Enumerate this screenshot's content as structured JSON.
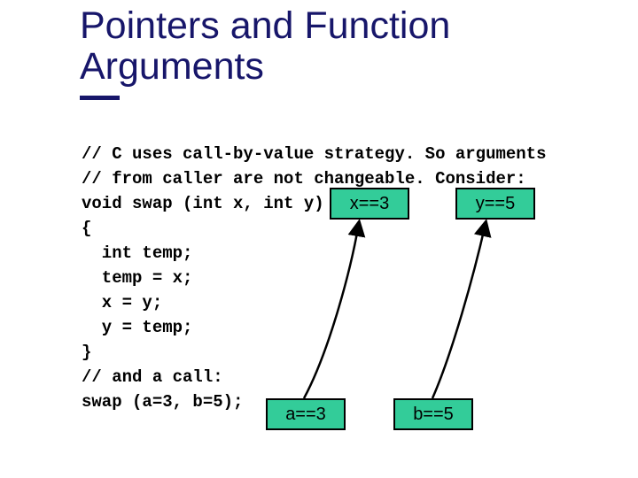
{
  "title": "Pointers and Function Arguments",
  "code": "// C uses call-by-value strategy. So arguments\n// from caller are not changeable. Consider:\nvoid swap (int x, int y)\n{\n  int temp;\n  temp = x;\n  x = y;\n  y = temp;\n}\n// and a call:\nswap (a=3, b=5);",
  "boxes": {
    "x": "x==3",
    "y": "y==5",
    "a": "a==3",
    "b": "b==5"
  }
}
